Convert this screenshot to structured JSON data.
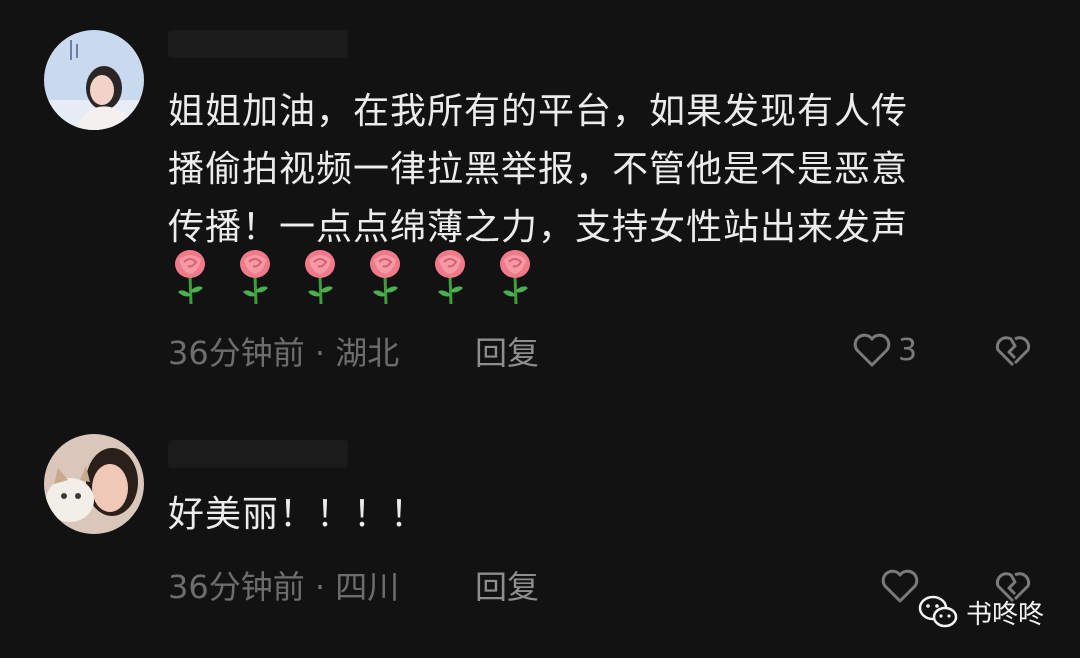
{
  "comments": [
    {
      "lines": [
        "姐姐加油，在我所有的平台，如果发现有人传",
        "播偷拍视频一律拉黑举报，不管他是不是恶意",
        "传播！一点点绵薄之力，支持女性站出来发声"
      ],
      "emoji_icons": [
        "rose-icon",
        "rose-icon",
        "rose-icon",
        "rose-icon",
        "rose-icon",
        "rose-icon"
      ],
      "meta": "36分钟前 · 湖北",
      "reply_label": "回复",
      "like_count": "3"
    },
    {
      "lines": [
        "好美丽！！！！"
      ],
      "meta": "36分钟前 · 四川",
      "reply_label": "回复"
    }
  ],
  "watermark": {
    "text": "书咚咚",
    "icon": "wechat-icon"
  },
  "colors": {
    "background": "#121212",
    "text": "#ececec",
    "meta": "#6d6d6d",
    "icon": "#7a7a7a"
  }
}
